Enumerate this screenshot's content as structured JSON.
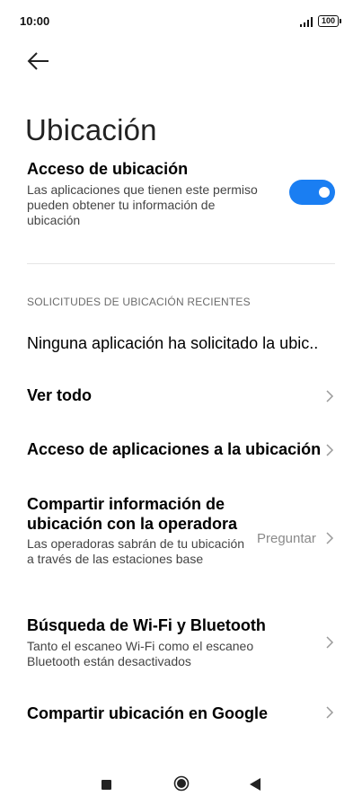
{
  "status": {
    "time": "10:00",
    "battery": "100"
  },
  "page": {
    "title": "Ubicación"
  },
  "location_access": {
    "title": "Acceso de ubicación",
    "subtitle": "Las aplicaciones que tienen este permiso pueden obtener tu información de ubicación",
    "enabled": true
  },
  "section": {
    "label": "SOLICITUDES DE UBICACIÓN RECIENTES"
  },
  "items": [
    {
      "title": "Ninguna aplicación ha solicitado la ubic.."
    },
    {
      "title": "Ver todo"
    },
    {
      "title": "Acceso de aplicaciones a la ubicación"
    },
    {
      "title": "Compartir información de ubicación con la operadora",
      "subtitle": "Las operadoras sabrán de tu ubicación a través de las estaciones base",
      "value": "Preguntar"
    },
    {
      "title": "Búsqueda de Wi-Fi y Bluetooth",
      "subtitle": "Tanto el escaneo Wi-Fi como el escaneo Bluetooth están desactivados"
    },
    {
      "title": "Compartir ubicación en Google"
    }
  ],
  "colors": {
    "accent": "#1a7ef2"
  },
  "icons": {
    "back": "back-arrow-icon",
    "chevron": "chevron-right-icon",
    "nav_recent": "square-icon",
    "nav_home": "circle-icon",
    "nav_back": "triangle-back-icon"
  }
}
